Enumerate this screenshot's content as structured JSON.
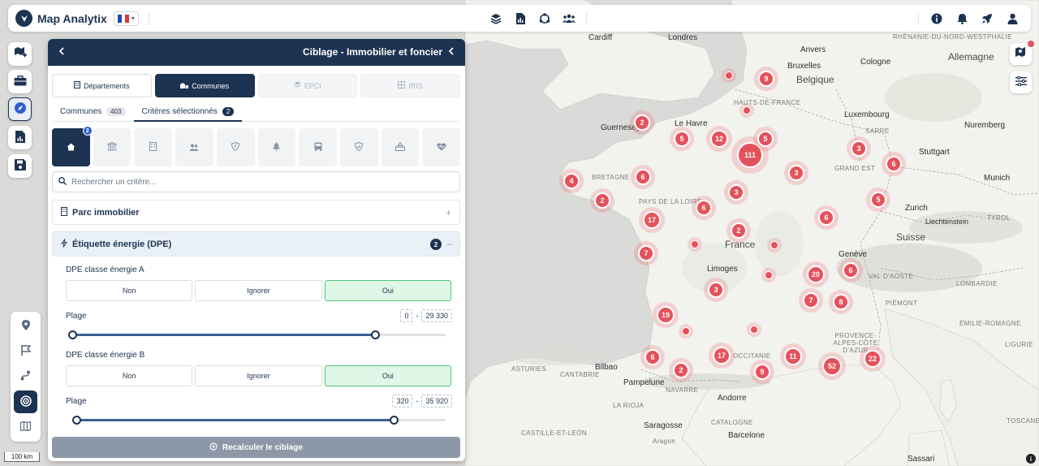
{
  "app": {
    "name": "Map Analytix",
    "language_icon": "france-flag-icon"
  },
  "topbar": {
    "center_icons": [
      "layers-icon",
      "report-icon",
      "network-icon",
      "users-icon"
    ],
    "right_icons": [
      "info-icon",
      "bell-icon",
      "rocket-icon",
      "user-icon"
    ]
  },
  "left_rail": [
    "map-add-icon",
    "briefcase-icon",
    "compass-icon",
    "report-icon",
    "save-icon"
  ],
  "map_tools": [
    "pin-icon",
    "flag-icon",
    "route-icon",
    "target-icon",
    "map-icon"
  ],
  "scale_label": "100 km",
  "panel": {
    "title": "Ciblage - Immobilier et foncier",
    "level_tabs": [
      {
        "label": "Départements",
        "icon": "building-icon",
        "state": "normal"
      },
      {
        "label": "Communes",
        "icon": "town-icon",
        "state": "active"
      },
      {
        "label": "EPCI",
        "icon": "layers-icon",
        "state": "disabled"
      },
      {
        "label": "IRIS",
        "icon": "grid-icon",
        "state": "disabled"
      }
    ],
    "sub_tabs": [
      {
        "label": "Communes",
        "count": "403"
      },
      {
        "label": "Critères sélectionnés",
        "count": "2"
      }
    ],
    "categories": [
      {
        "icon": "house-icon",
        "badge": "2"
      },
      {
        "icon": "bank-icon"
      },
      {
        "icon": "office-icon"
      },
      {
        "icon": "people-icon"
      },
      {
        "icon": "shield-icon"
      },
      {
        "icon": "tree-icon"
      },
      {
        "icon": "bus-icon"
      },
      {
        "icon": "shield-check-icon"
      },
      {
        "icon": "school-icon"
      },
      {
        "icon": "health-icon"
      }
    ],
    "search_placeholder": "Rechercher un critère...",
    "sections": [
      {
        "label": "Parc immobilier"
      },
      {
        "label": "Étiquette énergie (DPE)",
        "count": "2"
      }
    ],
    "criteria": [
      {
        "label": "DPE classe énergie A",
        "options": [
          "Non",
          "Ignorer",
          "Oui"
        ],
        "selected": "Oui",
        "range_label": "Plage",
        "min": "0",
        "max": "29 330",
        "range_fill": [
          0.0,
          0.81
        ]
      },
      {
        "label": "DPE classe énergie B",
        "options": [
          "Non",
          "Ignorer",
          "Oui"
        ],
        "selected": "Oui",
        "range_label": "Plage",
        "min": "320",
        "max": "35 920",
        "range_fill": [
          0.01,
          0.86
        ]
      }
    ],
    "range_separator": "-",
    "recalc_label": "Recalculer le ciblage"
  },
  "map": {
    "countries": [
      "Belgique",
      "Allemagne",
      "France",
      "Suisse",
      "Liechtenstein"
    ],
    "cities": [
      "Cardiff",
      "Londres",
      "Bruxelles",
      "Cologne",
      "Anvers",
      "Luxembourg",
      "Nuremberg",
      "Stuttgart",
      "Munich",
      "Zurich",
      "Le Havre",
      "Genève",
      "Limoges",
      "Bilbao",
      "Pampelune",
      "Saragosse",
      "Barcelone",
      "Andorre",
      "Guernesey",
      "Sassari",
      "Aragon"
    ],
    "regions": [
      "RHÉNANIE-DU-NORD-WESTPHALIE",
      "HAUTS-DE-FRANCE",
      "SARRE",
      "GRAND EST",
      "BRETAGNE",
      "PAYS DE LA LOIRE",
      "TYROL",
      "VAL D'AOSTE",
      "LOMBARDIE",
      "PIÉMONT",
      "ÉMILIE-ROMAGNE",
      "PROVENCE-ALPES-CÔTE D'AZUR",
      "OCCITANIE",
      "ASTURIES",
      "CANTABRIE",
      "NAVARRE",
      "LA RIOJA",
      "CASTILLE-ET-LEÓN",
      "CATALOGNE",
      "TOSCANE",
      "LIGURIE"
    ],
    "clusters": [
      "9",
      "2",
      "5",
      "12",
      "111",
      "5",
      "3",
      "6",
      "4",
      "6",
      "3",
      "2",
      "3",
      "6",
      "17",
      "6",
      "2",
      "7",
      "5",
      "20",
      "6",
      "7",
      "8",
      "3",
      "19",
      "17",
      "11",
      "52",
      "22",
      "6",
      "2",
      "9"
    ]
  }
}
